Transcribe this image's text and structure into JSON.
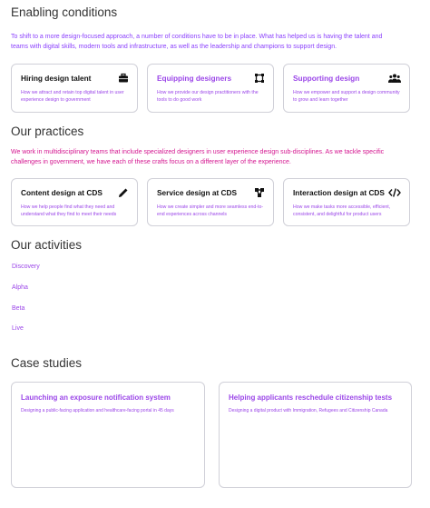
{
  "enabling": {
    "heading": "Enabling conditions",
    "intro": "To shift to a more design-focused approach, a number of conditions have to be in place. What has helped us is having the talent and teams with digital skills, modern tools and infrastructure, as well as the leadership and champions to support design.",
    "cards": [
      {
        "title": "Hiring design talent",
        "desc": "How we attract and retain top digital talent in user experience design to government",
        "icon": "briefcase-icon"
      },
      {
        "title": "Equipping designers",
        "desc": "How we provide our design practitioners with the tools to do good work",
        "icon": "frame-icon"
      },
      {
        "title": "Supporting design",
        "desc": "How we empower and support a design community to grow and learn together",
        "icon": "people-icon"
      }
    ]
  },
  "practices": {
    "heading": "Our practices",
    "intro": "We work in multidisciplinary teams that include specialized designers in user experience design sub-disciplines. As we tackle specific challenges in government, we have each of these crafts focus on a different layer of the experience.",
    "cards": [
      {
        "title": "Content design at CDS",
        "desc": "How we help people find what they need and understand what they find to meet their needs",
        "icon": "pencil-icon"
      },
      {
        "title": "Service design at CDS",
        "desc": "How we create simpler and more seamless end-to-end experiences across channels",
        "icon": "network-icon"
      },
      {
        "title": "Interaction design at CDS",
        "desc": "How we make tasks more accessible, efficient, consistent, and delightful for product users",
        "icon": "code-icon"
      }
    ]
  },
  "activities": {
    "heading": "Our activities",
    "links": [
      "Discovery",
      "Alpha",
      "Beta",
      "Live"
    ]
  },
  "cases": {
    "heading": "Case studies",
    "items": [
      {
        "title": "Launching an exposure notification system",
        "desc": "Designing a public-facing application and healthcare-facing portal in 45 days"
      },
      {
        "title": "Helping applicants reschedule citizenship tests",
        "desc": "Designing a digital product with Immigration, Refugees and Citizenship Canada"
      }
    ]
  },
  "colors": {
    "accent": "#8a3ffc",
    "link": "#9b46e8",
    "highlight": "#d4148f"
  }
}
